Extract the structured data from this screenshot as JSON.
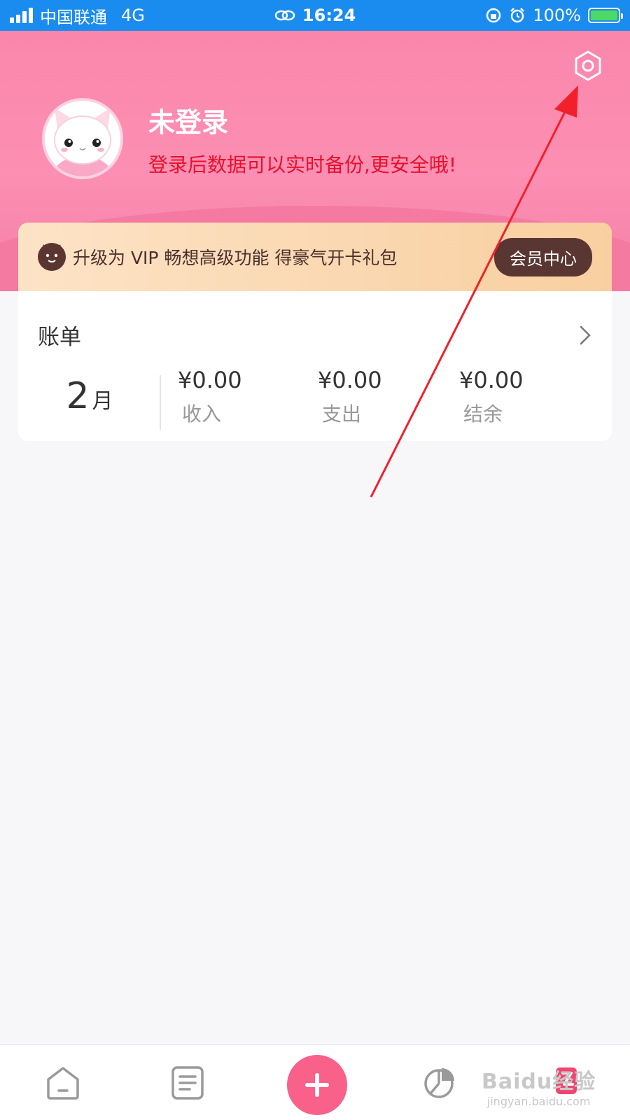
{
  "status_bar": {
    "carrier": "中国联通",
    "network": "4G",
    "time": "16:24",
    "battery": "100%"
  },
  "header": {
    "login_title": "未登录",
    "login_subtitle": "登录后数据可以实时备份,更安全哦!",
    "settings_icon": "gear-icon"
  },
  "vip_banner": {
    "text": "升级为 VIP 畅想高级功能 得豪气开卡礼包",
    "button_label": "会员中心"
  },
  "bill": {
    "title": "账单",
    "month_number": "2",
    "month_unit": "月",
    "stats": [
      {
        "value": "¥0.00",
        "label": "收入"
      },
      {
        "value": "¥0.00",
        "label": "支出"
      },
      {
        "value": "¥0.00",
        "label": "结余"
      }
    ]
  },
  "tab_bar": {
    "items": [
      "home-icon",
      "list-icon",
      "add-icon",
      "chart-icon",
      "profile-icon"
    ]
  },
  "watermark": {
    "main": "Baidu经验",
    "sub": "jingyan.baidu.com"
  },
  "colors": {
    "header_pink": "#fb86ac",
    "accent_red": "#e8102a",
    "vip_button": "#5a3632",
    "add_button": "#f9608a",
    "status_bar_blue": "#1a8cf0"
  }
}
